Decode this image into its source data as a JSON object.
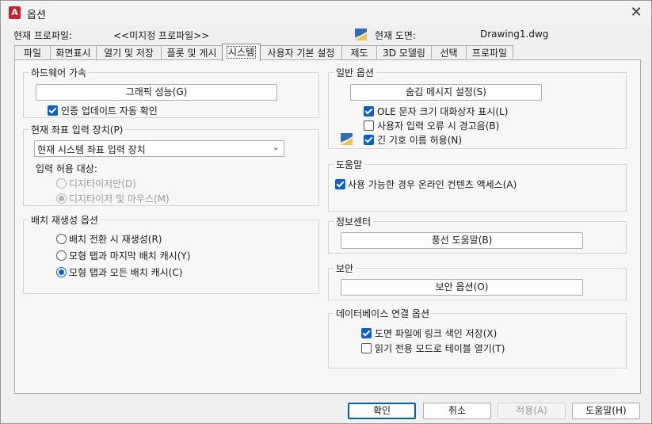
{
  "window": {
    "title": "옵션",
    "app_icon": "A"
  },
  "profile": {
    "current_profile_label": "현재 프로파일:",
    "current_profile_value": "<<미지정 프로파일>>",
    "current_drawing_label": "현재 도면:",
    "current_drawing_value": "Drawing1.dwg"
  },
  "tabs": [
    {
      "label": "파일"
    },
    {
      "label": "화면표시"
    },
    {
      "label": "열기 및 저장"
    },
    {
      "label": "플롯 및 게시"
    },
    {
      "label": "시스템"
    },
    {
      "label": "사용자 기본 설정"
    },
    {
      "label": "제도"
    },
    {
      "label": "3D 모델링"
    },
    {
      "label": "선택"
    },
    {
      "label": "프로파일"
    }
  ],
  "active_tab": "시스템",
  "hardware": {
    "title": "하드웨어 가속",
    "graphics_button": "그래픽 성능(G)",
    "auto_check_label": "인증 업데이트 자동 확인",
    "auto_check_checked": true
  },
  "pointing": {
    "title": "현재 좌표 입력 장치(P)",
    "selected": "현재 시스템 좌표 입력 장치",
    "accept_label": "입력 허용 대상:",
    "digitizer_only": "디지타이저만(D)",
    "digitizer_mouse": "디지타이저 및 마우스(M)",
    "selected_option": "digitizer_mouse"
  },
  "layout_regen": {
    "title": "배치 재생성 옵션",
    "option1": "배치 전환 시 재생성(R)",
    "option2": "모형 탭과 마지막 배치 캐시(Y)",
    "option3": "모형 탭과 모든 배치 캐시(C)",
    "selected_option": "option3"
  },
  "general": {
    "title": "일반 옵션",
    "hidden_msg_button": "숨김 메시지 설정(S)",
    "ole_label": "OLE 문자 크기 대화상자 표시(L)",
    "ole_checked": true,
    "beep_label": "사용자 입력 오류 시 경고음(B)",
    "beep_checked": false,
    "long_names_label": "긴 기호 이름 허용(N)",
    "long_names_checked": true
  },
  "help": {
    "title": "도움말",
    "online_label": "사용 가능한 경우 온라인 컨텐츠 액세스(A)",
    "online_checked": true
  },
  "infocenter": {
    "title": "정보센터",
    "balloon_button": "풍선 도움말(B)"
  },
  "security": {
    "title": "보안",
    "security_button": "보안 옵션(O)"
  },
  "dbconnect": {
    "title": "데이터베이스 연결 옵션",
    "store_links_label": "도면 파일에 링크 색인 저장(X)",
    "store_links_checked": true,
    "readonly_label": "읽기 전용 모드로 테이블 열기(T)",
    "readonly_checked": false
  },
  "footer": {
    "ok": "확인",
    "cancel": "취소",
    "apply": "적용(A)",
    "help": "도움말(H)"
  },
  "colors": {
    "accent": "#0a62c6",
    "app_icon": "#c8232c"
  }
}
